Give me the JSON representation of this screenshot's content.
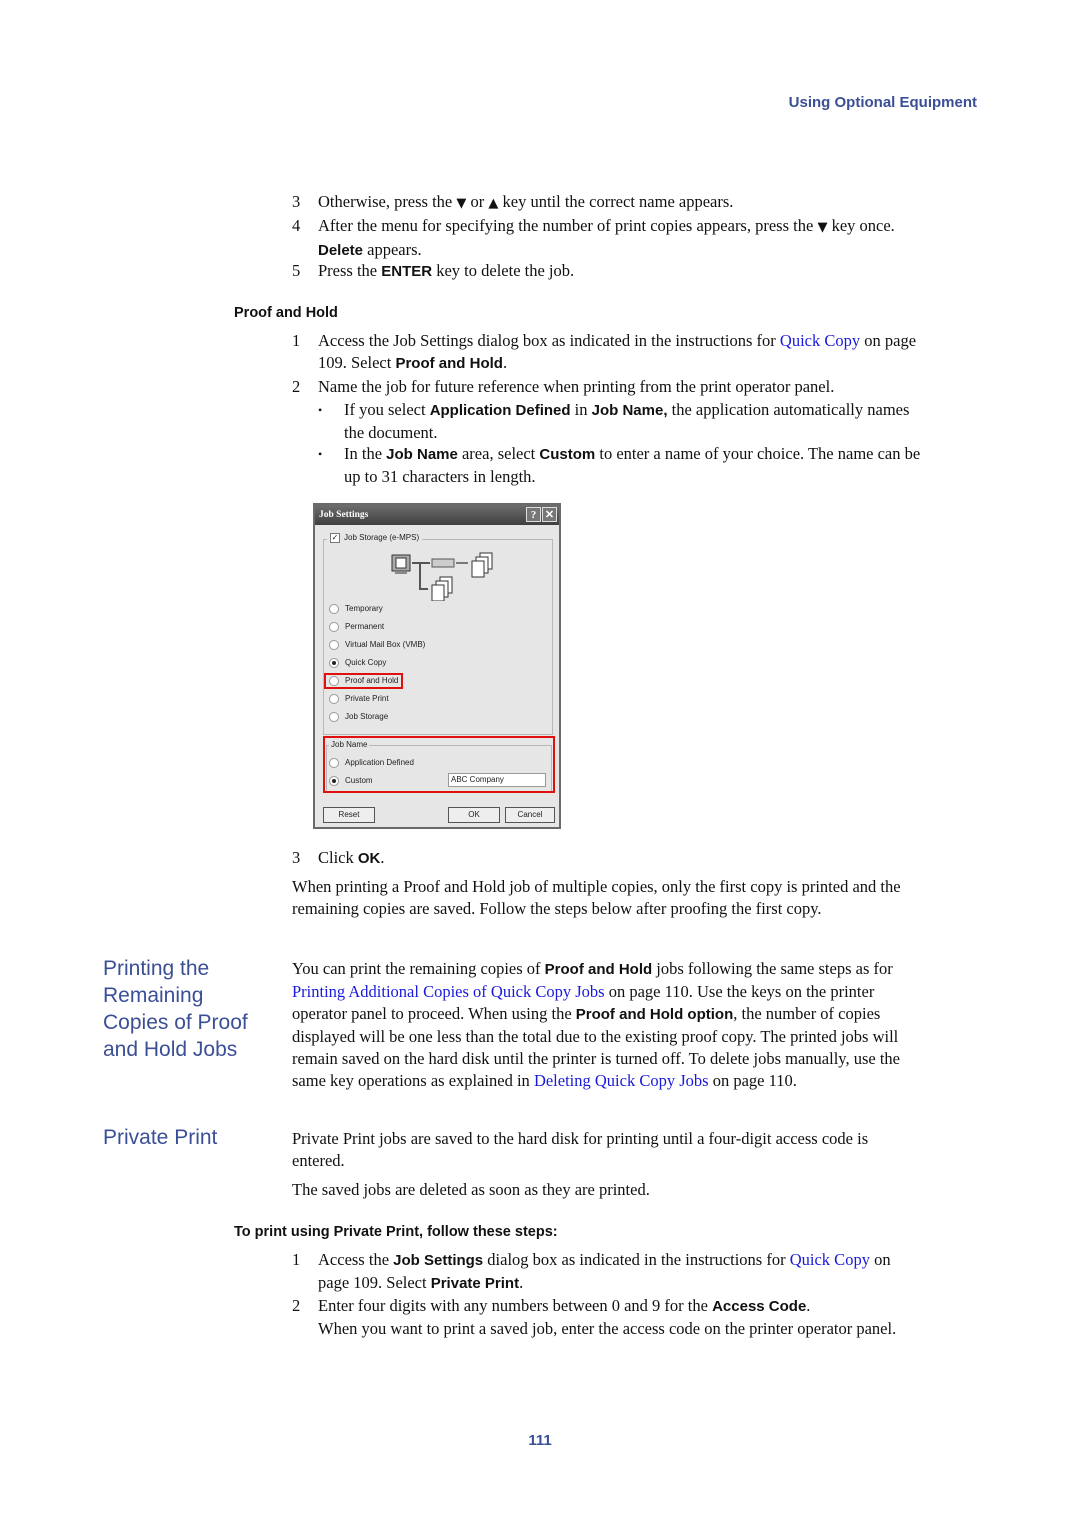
{
  "running_head": "Using Optional Equipment",
  "page_number": "111",
  "top_steps": [
    {
      "num": "3",
      "parts": [
        "Otherwise, press the ",
        "▼",
        " or ",
        "▲",
        " key until the correct name appears."
      ]
    },
    {
      "num": "4",
      "line1_a": "After the menu for specifying the number of print copies appears, press the ",
      "arrow": "▼",
      "line1_b": " key once.",
      "bold": "Delete",
      "line2": " appears."
    },
    {
      "num": "5",
      "a": "Press the ",
      "bold": "ENTER",
      "b": " key to delete the job."
    }
  ],
  "proof_and_hold": {
    "heading": "Proof and Hold",
    "step1": {
      "num": "1",
      "a": "Access the Job Settings dialog box as indicated in the instructions for ",
      "link": "Quick Copy",
      "b": " on page",
      "c": "109. Select ",
      "bold": "Proof and Hold",
      "d": "."
    },
    "step2": {
      "num": "2",
      "text": "Name the job for future reference when printing from the print operator panel."
    },
    "bullets": [
      {
        "a": "If you select ",
        "b1": "Application Defined",
        "c": " in ",
        "b2": "Job Name,",
        "d": " the application automatically names",
        "e": "the document."
      },
      {
        "a": "In the ",
        "b1": "Job Name",
        "c": " area, select ",
        "b2": "Custom",
        "d": " to enter a name of your choice. The name can be",
        "e": "up to 31 characters in length."
      }
    ],
    "bullet_glyph": "•",
    "step3": {
      "num": "3",
      "a": "Click ",
      "bold": "OK",
      "b": "."
    },
    "para": [
      "When printing a Proof and Hold job of multiple copies, only the first copy is printed and the",
      "remaining copies are saved. Follow the steps below after proofing the first copy."
    ]
  },
  "dialog": {
    "title": "Job Settings",
    "help_btn": "?",
    "close_btn": "✕",
    "job_storage_check": "Job Storage (e-MPS)",
    "job_storage_checked": true,
    "options": [
      {
        "label": "Temporary",
        "selected": false
      },
      {
        "label": "Permanent",
        "selected": false
      },
      {
        "label": "Virtual Mail Box (VMB)",
        "selected": false
      },
      {
        "label": "Quick Copy",
        "selected": true
      },
      {
        "label": "Proof and Hold",
        "selected": false,
        "highlighted": true
      },
      {
        "label": "Private Print",
        "selected": false
      },
      {
        "label": "Job Storage",
        "selected": false
      }
    ],
    "job_name_group": "Job Name",
    "job_name_options": [
      {
        "label": "Application Defined",
        "selected": false
      },
      {
        "label": "Custom",
        "selected": true
      }
    ],
    "custom_value": "ABC Company",
    "buttons": {
      "reset": "Reset",
      "ok": "OK",
      "cancel": "Cancel"
    },
    "highlight_color": "#e01010"
  },
  "remaining": {
    "side_heading": [
      "Printing the",
      "Remaining",
      "Copies of Proof",
      "and Hold Jobs"
    ],
    "lines": [
      {
        "a": "You can print the remaining copies of ",
        "bold": "Proof and Hold",
        "b": " jobs following the same steps as for"
      },
      {
        "link": "Printing Additional Copies of Quick Copy Jobs",
        "b": " on page 110. Use the keys on the printer"
      },
      {
        "a": "operator panel to proceed. When using the ",
        "bold": "Proof and Hold option",
        "b": ", the number of copies"
      },
      {
        "a": "displayed will be one less than the total due to the existing proof copy. The printed jobs will"
      },
      {
        "a": "remain saved on the hard disk until the printer is turned off. To delete jobs manually, use the"
      },
      {
        "a": "same key operations as explained in ",
        "link": "Deleting Quick Copy Jobs",
        "b": " on page 110."
      }
    ]
  },
  "private_print": {
    "side_heading": "Private Print",
    "para1": [
      "Private Print jobs are saved to the hard disk for printing until a four-digit access code is",
      "entered."
    ],
    "para2": "The saved jobs are deleted as soon as they are printed.",
    "subheading": "To print using Private Print, follow these steps:",
    "step1": {
      "num": "1",
      "a": "Access the ",
      "bold": "Job Settings",
      "b": " dialog box as indicated in the instructions for ",
      "link": "Quick Copy",
      "c": " on",
      "d": "page 109. Select ",
      "bold2": "Private Print",
      "e": "."
    },
    "step2": {
      "num": "2",
      "a": "Enter four digits with any numbers between 0 and 9 for the ",
      "bold": "Access Code",
      "b": "."
    },
    "step2_note": "When you want to print a saved job, enter the access code on the printer operator panel."
  },
  "colors": {
    "heading_blue": "#3b4f96",
    "link_blue": "#1a1adc"
  }
}
